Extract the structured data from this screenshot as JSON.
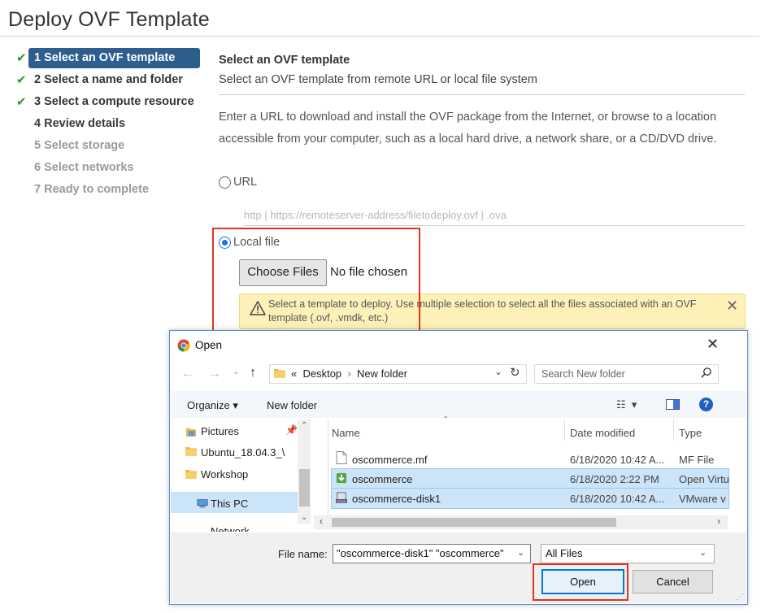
{
  "page": {
    "title": "Deploy OVF Template"
  },
  "steps": [
    {
      "label": "1 Select an OVF template",
      "state": "active"
    },
    {
      "label": "2 Select a name and folder",
      "state": "done"
    },
    {
      "label": "3 Select a compute resource",
      "state": "done"
    },
    {
      "label": "4 Review details",
      "state": "pending"
    },
    {
      "label": "5 Select storage",
      "state": "disabled"
    },
    {
      "label": "6 Select networks",
      "state": "disabled"
    },
    {
      "label": "7 Ready to complete",
      "state": "disabled"
    }
  ],
  "main": {
    "title": "Select an OVF template",
    "subtitle": "Select an OVF template from remote URL or local file system",
    "description": "Enter a URL to download and install the OVF package from the Internet, or browse to a location accessible from your computer, such as a local hard drive, a network share, or a CD/DVD drive.",
    "url_option": "URL",
    "url_placeholder": "http | https://remoteserver-address/filetodeploy.ovf | .ova",
    "local_option": "Local file",
    "choose_button": "Choose Files",
    "no_file": "No file chosen",
    "warning": "Select a template to deploy. Use multiple selection to select all the files associated with an OVF template (.ovf, .vmdk, etc.)",
    "selected_option": "Local file"
  },
  "dialog": {
    "title": "Open",
    "address": {
      "prefix": "«",
      "crumbs": [
        "Desktop",
        "New folder"
      ]
    },
    "search_placeholder": "Search New folder",
    "toolbar": {
      "organize": "Organize ▾",
      "new_folder": "New folder"
    },
    "nav": [
      "Pictures",
      "Ubuntu_18.04.3_\\",
      "Workshop",
      "This PC",
      "Network"
    ],
    "columns": [
      "Name",
      "Date modified",
      "Type"
    ],
    "files": [
      {
        "name": "oscommerce.mf",
        "date": "6/18/2020 10:42 A...",
        "type": "MF File",
        "selected": false
      },
      {
        "name": "oscommerce",
        "date": "6/18/2020 2:22 PM",
        "type": "Open Virtu",
        "selected": true
      },
      {
        "name": "oscommerce-disk1",
        "date": "6/18/2020 10:42 A...",
        "type": "VMware v",
        "selected": true
      }
    ],
    "file_name_label": "File name:",
    "file_name_value": "\"oscommerce-disk1\" \"oscommerce\"",
    "filter": "All Files",
    "open_button": "Open",
    "cancel_button": "Cancel"
  },
  "colors": {
    "accent": "#2e5e8e",
    "check": "#2b9b2b",
    "highlight": "#e2341d",
    "warning_bg": "#fdf1b8"
  }
}
